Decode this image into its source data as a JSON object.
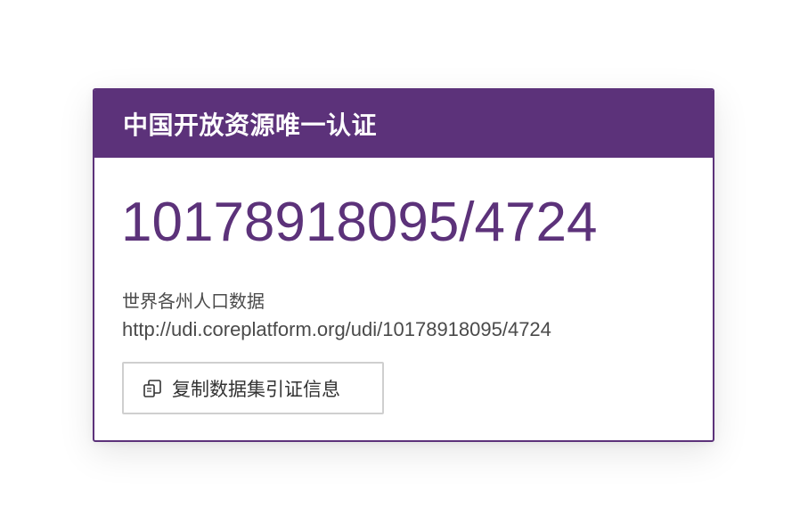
{
  "card": {
    "title": "中国开放资源唯一认证",
    "udi": "10178918095/4724",
    "dataset_name": "世界各州人口数据",
    "url": "http://udi.coreplatform.org/udi/10178918095/4724",
    "copy_button": {
      "label": "复制数据集引证信息",
      "icon": "copy-icon"
    }
  },
  "colors": {
    "accent": "#5c327a",
    "text": "#4a4a4a",
    "button_border": "#cfcfcf"
  }
}
